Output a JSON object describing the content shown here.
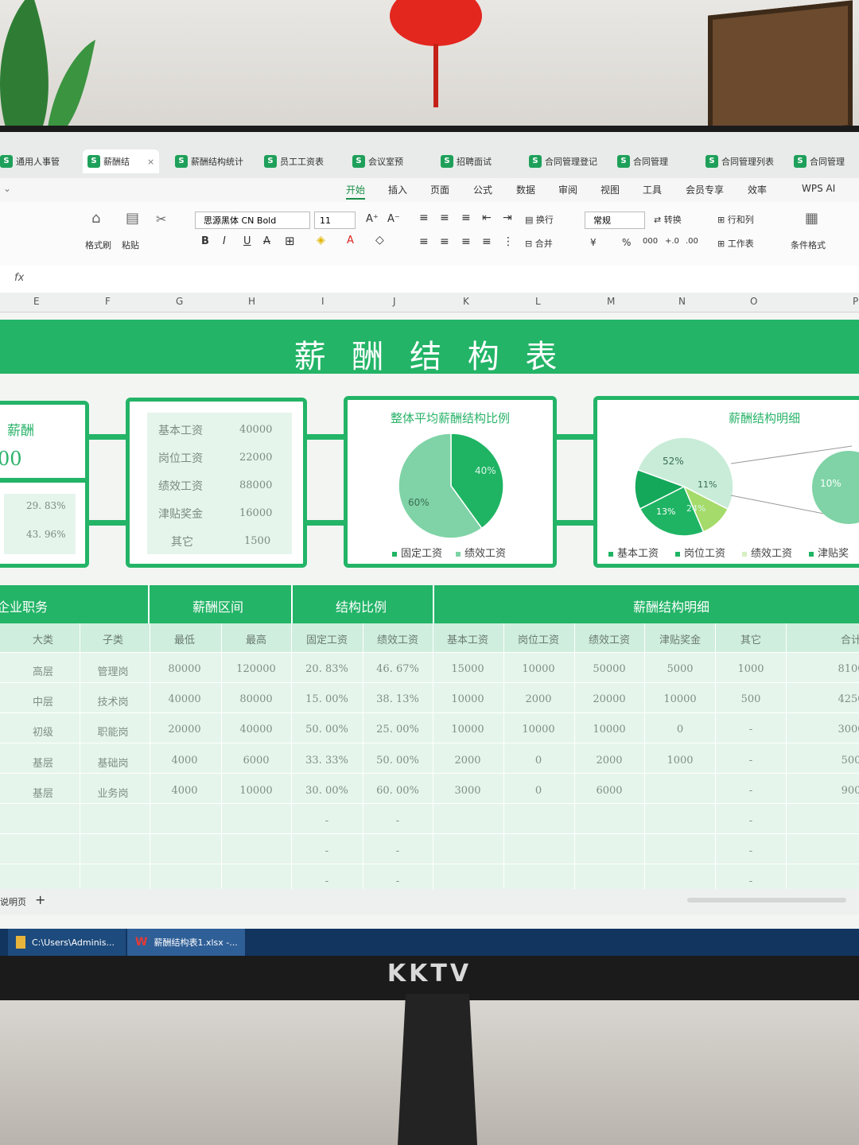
{
  "tabs": [
    {
      "label": "通用人事管"
    },
    {
      "label": "薪酬结"
    },
    {
      "label": "薪酬结构统计"
    },
    {
      "label": "员工工资表"
    },
    {
      "label": "会议室预"
    },
    {
      "label": "招聘面试"
    },
    {
      "label": "合同管理登记"
    },
    {
      "label": "合同管理"
    },
    {
      "label": "合同管理列表"
    },
    {
      "label": "合同管理"
    }
  ],
  "menu": [
    "开始",
    "插入",
    "页面",
    "公式",
    "数据",
    "审阅",
    "视图",
    "工具",
    "会员专享",
    "效率",
    "WPS AI"
  ],
  "toolbar": {
    "format_painter": "格式刷",
    "paste": "粘贴",
    "font_name": "思源黑体 CN Bold",
    "font_size": "11",
    "wrap": "换行",
    "merge": "合并",
    "number_format": "常规",
    "convert": "转换",
    "rows_cols": "行和列",
    "worksheet": "工作表",
    "cond_format": "条件格式"
  },
  "formula_bar": {
    "fx": "fx"
  },
  "columns": [
    "E",
    "F",
    "G",
    "H",
    "I",
    "J",
    "K",
    "L",
    "M",
    "N",
    "O",
    "P"
  ],
  "dashboard": {
    "title": "薪 酬 结 构 表",
    "left_panel": {
      "label": "薪酬",
      "big_value": "00",
      "pct1": "29. 83%",
      "pct2": "43. 96%"
    },
    "kv_panel": [
      {
        "key": "基本工资",
        "value": "40000"
      },
      {
        "key": "岗位工资",
        "value": "22000"
      },
      {
        "key": "绩效工资",
        "value": "88000"
      },
      {
        "key": "津贴奖金",
        "value": "16000"
      },
      {
        "key": "其它",
        "value": "1500"
      }
    ],
    "pie1": {
      "title": "整体平均薪酬结构比例",
      "label_fixed": "60%",
      "label_perf": "40%",
      "legend": [
        "固定工资",
        "绩效工资"
      ],
      "colors": [
        "#7fd3a6",
        "#1fb463"
      ]
    },
    "pie2": {
      "title": "薪酬结构明细",
      "labels": {
        "basic": "52%",
        "post": "13%",
        "perf": "24%",
        "allow": "11%",
        "other": "10%"
      },
      "legend": [
        "基本工资",
        "岗位工资",
        "绩效工资",
        "津贴奖"
      ],
      "colors": [
        "#c8ecd8",
        "#1fb463",
        "#d8efc4",
        "#a5db6a"
      ]
    }
  },
  "chart_data": [
    {
      "type": "pie",
      "title": "整体平均薪酬结构比例",
      "categories": [
        "固定工资",
        "绩效工资"
      ],
      "values": [
        60,
        40
      ]
    },
    {
      "type": "pie",
      "title": "薪酬结构明细",
      "categories": [
        "基本工资",
        "岗位工资",
        "绩效工资",
        "津贴奖金"
      ],
      "values": [
        52,
        13,
        24,
        11
      ]
    }
  ],
  "table": {
    "group_headers": [
      "企业职务",
      "薪酬区间",
      "结构比例",
      "薪酬结构明细"
    ],
    "headers": [
      "大类",
      "子类",
      "最低",
      "最高",
      "固定工资",
      "绩效工资",
      "基本工资",
      "岗位工资",
      "绩效工资",
      "津贴奖金",
      "其它",
      "合计"
    ],
    "rows": [
      [
        "高层",
        "管理岗",
        "80000",
        "120000",
        "20. 83%",
        "46. 67%",
        "15000",
        "10000",
        "50000",
        "5000",
        "1000",
        "8100"
      ],
      [
        "中层",
        "技术岗",
        "40000",
        "80000",
        "15. 00%",
        "38. 13%",
        "10000",
        "2000",
        "20000",
        "10000",
        "500",
        "4250"
      ],
      [
        "初级",
        "职能岗",
        "20000",
        "40000",
        "50. 00%",
        "25. 00%",
        "10000",
        "10000",
        "10000",
        "0",
        "-",
        "3000"
      ],
      [
        "基层",
        "基础岗",
        "4000",
        "6000",
        "33. 33%",
        "50. 00%",
        "2000",
        "0",
        "2000",
        "1000",
        "-",
        "500"
      ],
      [
        "基层",
        "业务岗",
        "4000",
        "10000",
        "30. 00%",
        "60. 00%",
        "3000",
        "0",
        "6000",
        "",
        "-",
        "900"
      ],
      [
        "",
        "",
        "",
        "",
        "-",
        "-",
        "",
        "",
        "",
        "",
        "-",
        ""
      ],
      [
        "",
        "",
        "",
        "",
        "-",
        "-",
        "",
        "",
        "",
        "",
        "-",
        ""
      ],
      [
        "",
        "",
        "",
        "",
        "-",
        "-",
        "",
        "",
        "",
        "",
        "-",
        ""
      ]
    ]
  },
  "sheet_tab": "说明页",
  "taskbar": [
    {
      "label": "C:\\Users\\Adminis..."
    },
    {
      "label": "薪酬结构表1.xlsx -..."
    }
  ],
  "monitor_brand": "KKTV"
}
